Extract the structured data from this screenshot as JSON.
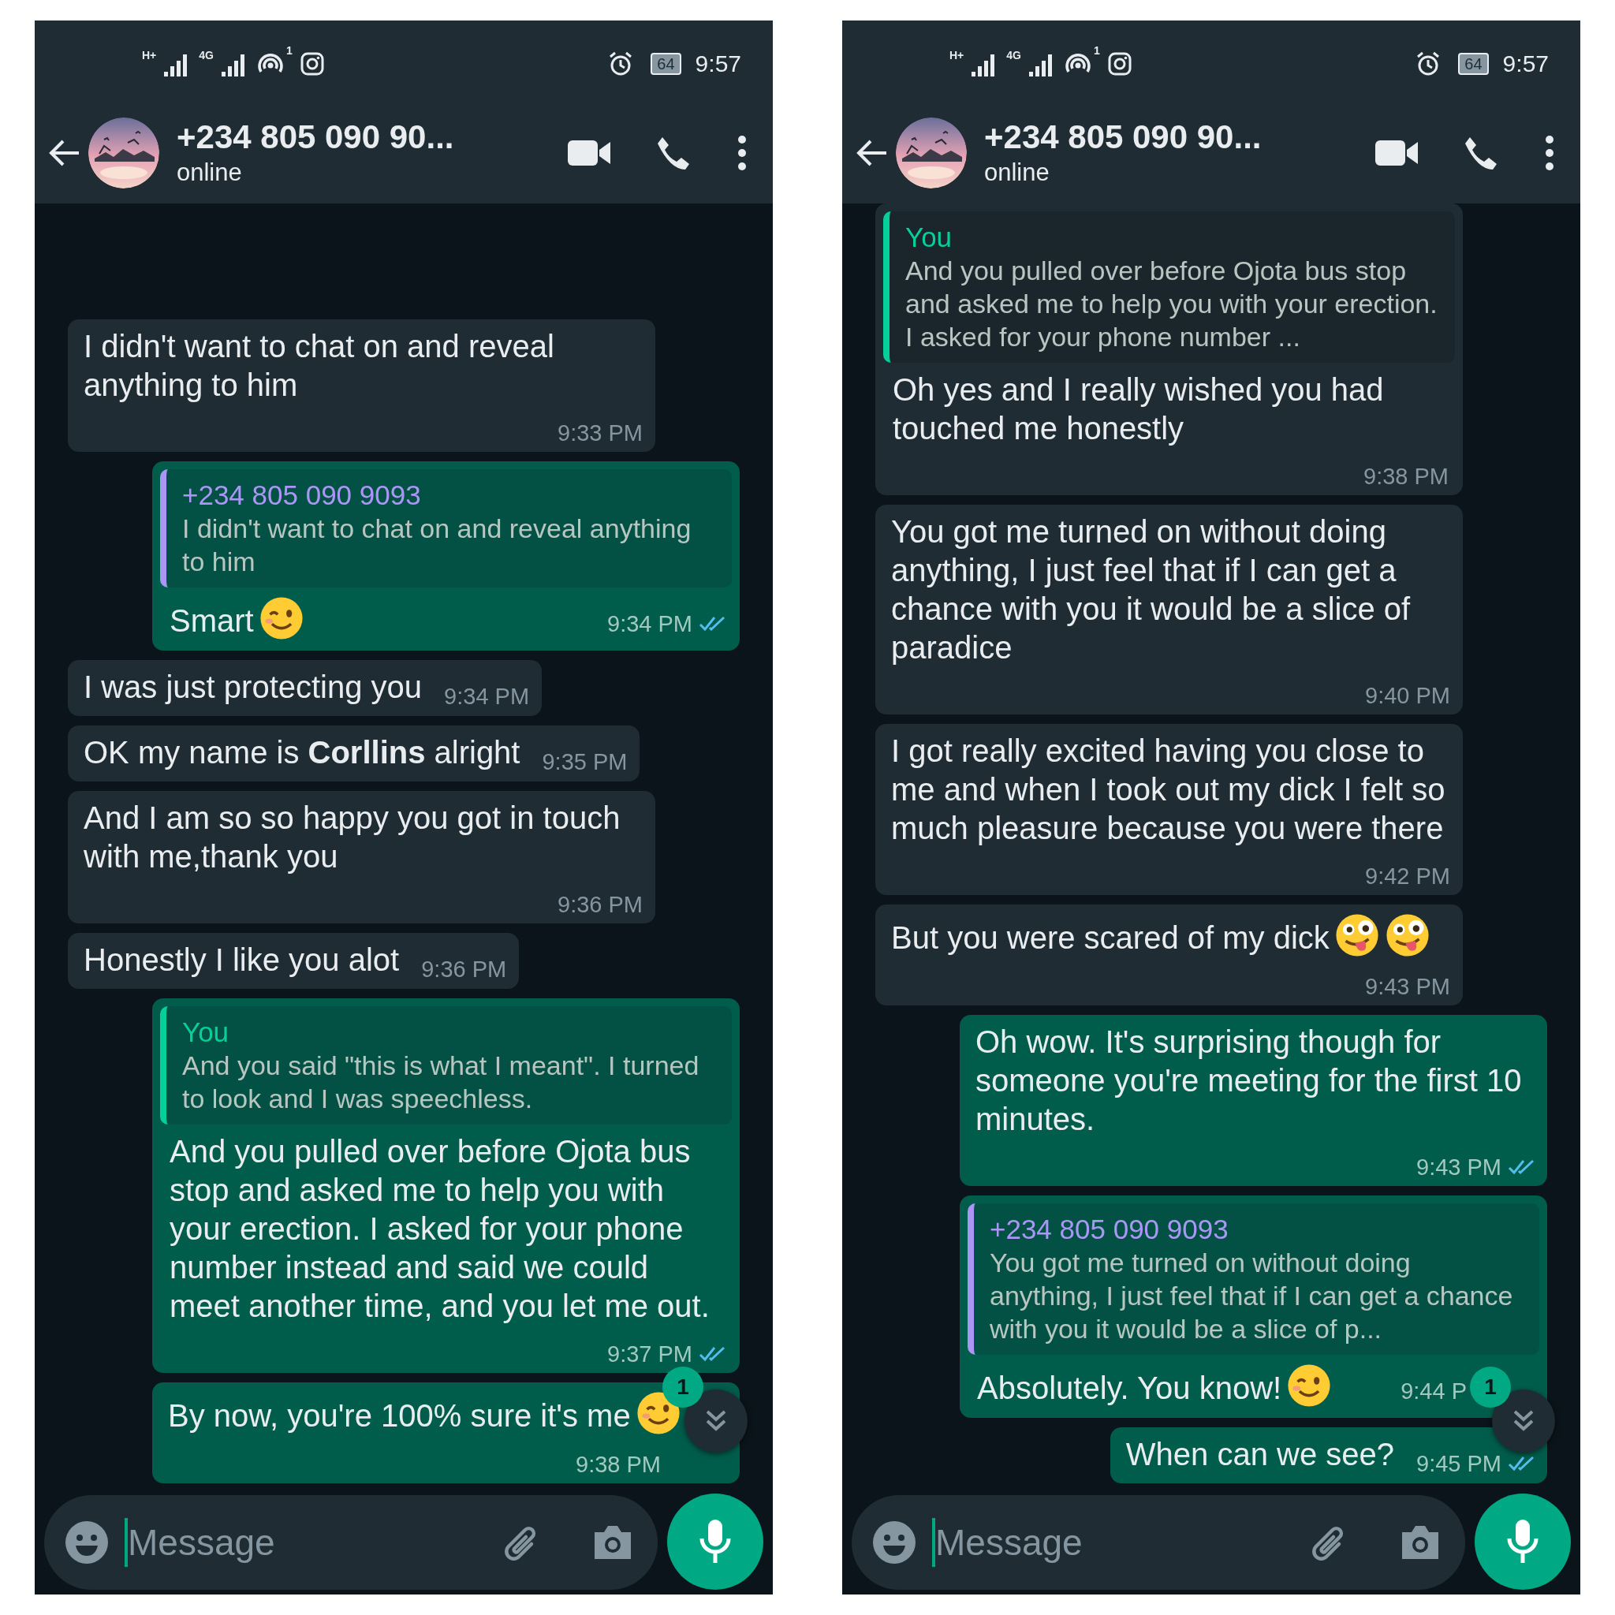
{
  "phones": [
    {
      "status_bar": {
        "network_1": "H+",
        "network_2": "4G",
        "hotspot_count": "1",
        "battery": "64",
        "time": "9:57"
      },
      "header": {
        "title": "+234 805 090 90...",
        "subtitle": "online"
      },
      "messages": [
        {
          "kind": "incoming",
          "text": "I didn't want to chat on and reveal anything to him",
          "time": "9:33 PM"
        },
        {
          "kind": "outgoing",
          "quote": {
            "kind": "self",
            "author": "+234 805 090 9093",
            "text": "I didn't want to chat on and reveal anything to him"
          },
          "text": "Smart",
          "emoji": [
            {
              "kind": "wink"
            }
          ],
          "time": "9:34 PM",
          "read": true
        },
        {
          "kind": "incoming",
          "text": "I was just protecting you",
          "time": "9:34 PM"
        },
        {
          "kind": "incoming",
          "text": "OK my name is **Corllins** alright",
          "time": "9:35 PM"
        },
        {
          "kind": "incoming",
          "text": "And I am so so happy you got in touch with me,thank you",
          "time": "9:36 PM"
        },
        {
          "kind": "incoming",
          "text": "Honestly I like you alot",
          "time": "9:36 PM"
        },
        {
          "kind": "outgoing",
          "quote": {
            "kind": "contact",
            "author": "You",
            "text": "And you said \"this is what I meant\". I turned to look and I was speechless."
          },
          "text": "And you pulled over before Ojota bus stop and asked me to help you  with your erection. I asked for your phone number instead and said we could meet another time, and you let me out.",
          "time": "9:37 PM",
          "read": true
        },
        {
          "kind": "outgoing",
          "text": "By now, you're  100% sure it's me",
          "emoji": [
            {
              "kind": "wink"
            }
          ],
          "time": "9:38 PM"
        }
      ],
      "scroll_button": {
        "unread": "1"
      },
      "composer": {
        "placeholder": "Message"
      }
    },
    {
      "status_bar": {
        "network_1": "H+",
        "network_2": "4G",
        "hotspot_count": "1",
        "battery": "64",
        "time": "9:57"
      },
      "header": {
        "title": "+234 805 090 90...",
        "subtitle": "online"
      },
      "messages": [
        {
          "kind": "incoming",
          "quote": {
            "kind": "contact",
            "author": "You",
            "text": "And you pulled over before Ojota bus stop and asked me to help you  with your erection. I asked for your phone number ..."
          },
          "text": "Oh yes and I really wished you had touched me honestly",
          "time": "9:38 PM"
        },
        {
          "kind": "incoming",
          "text": "You got me turned on without doing anything,  I just feel that if I can get a chance with you it would be  a slice of paradice",
          "time": "9:40 PM"
        },
        {
          "kind": "incoming",
          "text": "I got really excited having you close to me and when I took out my dick I felt so much pleasure because you were there",
          "time": "9:42 PM"
        },
        {
          "kind": "incoming",
          "text": "But you were scared of my dick",
          "emoji": [
            {
              "kind": "tongue"
            },
            {
              "kind": "tongue"
            }
          ],
          "time": "9:43 PM"
        },
        {
          "kind": "outgoing",
          "text": "Oh wow. It's surprising though for someone you're meeting for the first 10 minutes.",
          "time": "9:43 PM",
          "read": true
        },
        {
          "kind": "outgoing",
          "quote": {
            "kind": "self",
            "author": "+234 805 090 9093",
            "text": "You got me turned on without doing anything,  I just feel that if I can get a chance with you it would be  a slice of p..."
          },
          "text": "Absolutely. You know!",
          "emoji": [
            {
              "kind": "wink"
            }
          ],
          "time": "9:44 P"
        },
        {
          "kind": "outgoing",
          "text": "When can we see?",
          "time": "9:45 PM",
          "read": true
        }
      ],
      "scroll_button": {
        "unread": "1"
      },
      "composer": {
        "placeholder": "Message"
      }
    }
  ]
}
